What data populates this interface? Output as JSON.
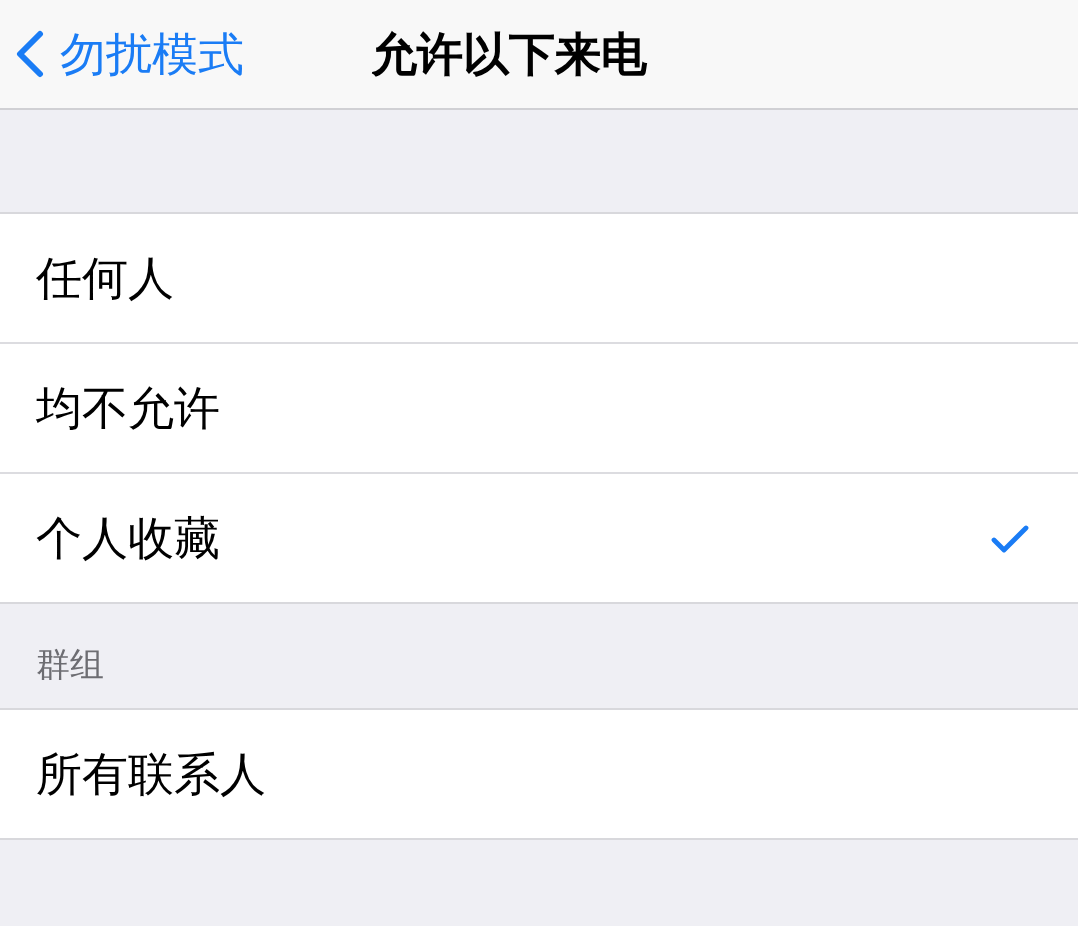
{
  "nav": {
    "back": "勿扰模式",
    "title": "允许以下来电"
  },
  "sections": [
    {
      "items": [
        {
          "label": "任何人",
          "selected": false
        },
        {
          "label": "均不允许",
          "selected": false
        },
        {
          "label": "个人收藏",
          "selected": true
        }
      ]
    },
    {
      "header": "群组",
      "items": [
        {
          "label": "所有联系人",
          "selected": false
        }
      ]
    }
  ]
}
